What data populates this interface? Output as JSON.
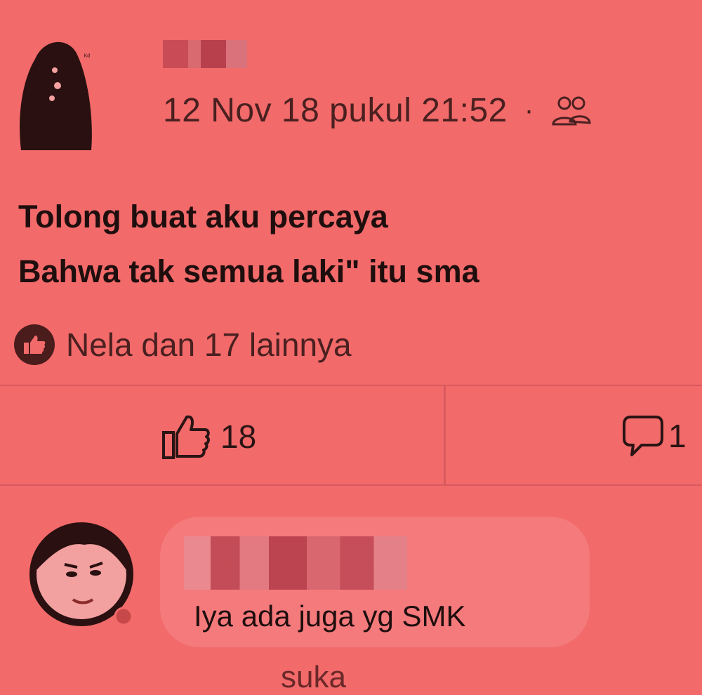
{
  "post": {
    "timestamp": "12 Nov 18 pukul 21:52",
    "separator": "·",
    "audience_icon": "friends-icon",
    "lines": [
      "Tolong buat aku percaya",
      "Bahwa tak semua laki\" itu sma"
    ],
    "reactions_text": "Nela dan 17 lainnya"
  },
  "actions": {
    "like_count": "18",
    "comment_count": "1"
  },
  "comment": {
    "text": "Iya ada juga yg SMK",
    "like_label": "suka"
  }
}
